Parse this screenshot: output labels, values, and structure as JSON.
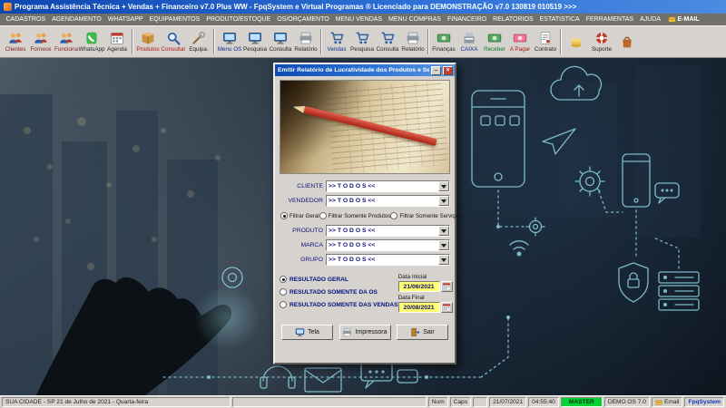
{
  "titlebar": {
    "title": "Programa Assistência Técnica + Vendas + Financeiro v7.0 Plus WW  -  FpqSystem e Virtual Programas ®  Licenciado para  DEMONSTRAÇÃO v7.0 130819 010519 >>>"
  },
  "menubar": {
    "items": [
      "CADASTROS",
      "AGENDAMENTO",
      "WHATSAPP",
      "EQUIPAMENTOS",
      "PRODUTO/ESTOQUE",
      "OS/ORÇAMENTO",
      "MENU VENDAS",
      "MENU COMPRAS",
      "FINANCEIRO",
      "RELATORIOS",
      "ESTATISTICA",
      "FERRAMENTAS",
      "AJUDA"
    ],
    "email": "E-MAIL"
  },
  "toolbar": {
    "buttons": [
      {
        "label": "Clientes",
        "icon": "people-icon"
      },
      {
        "label": "Fornece",
        "icon": "people-icon"
      },
      {
        "label": "Funciona",
        "icon": "people-icon"
      },
      {
        "label": "WhatsApp",
        "icon": "whatsapp-phone-icon"
      },
      {
        "label": "Agenda",
        "icon": "calendar-icon"
      },
      {
        "label": "Produtos",
        "icon": "box-icon"
      },
      {
        "label": "Consultar",
        "icon": "search-icon"
      },
      {
        "label": "Equipa.",
        "icon": "tools-icon"
      },
      {
        "label": "Menu OS",
        "icon": "monitor-icon"
      },
      {
        "label": "Pesquisa",
        "icon": "monitor-icon"
      },
      {
        "label": "Consulta",
        "icon": "monitor-icon"
      },
      {
        "label": "Relatório",
        "icon": "printer-icon"
      },
      {
        "label": "Vendas",
        "icon": "cart-icon"
      },
      {
        "label": "Pesquisa",
        "icon": "cart-icon"
      },
      {
        "label": "Consulta",
        "icon": "cart-icon"
      },
      {
        "label": "Relatório",
        "icon": "printer-icon"
      },
      {
        "label": "Finanças",
        "icon": "money-icon"
      },
      {
        "label": "CAIXA",
        "icon": "cash-register-icon"
      },
      {
        "label": "Receber",
        "icon": "money-icon"
      },
      {
        "label": "A Pagar",
        "icon": "money-icon"
      },
      {
        "label": "Contrato",
        "icon": "contract-icon"
      },
      {
        "label": "",
        "icon": "coins-icon"
      },
      {
        "label": "Suporte",
        "icon": "support-icon"
      },
      {
        "label": "",
        "icon": "bag-icon"
      }
    ]
  },
  "dialog": {
    "title": "Emitir Relatório de Lucratividade dos Produtos e Serviços",
    "cliente_label": "CLIENTE",
    "cliente_value": ">> T O D O S <<",
    "vendedor_label": "VENDEDOR",
    "vendedor_value": ">> T O D O S <<",
    "filter_options": [
      "Filtrar Geral",
      "Filtrar Somente Produtos",
      "Filtrar Somente Serviços"
    ],
    "filter_selected": "Filtrar Geral",
    "produto_label": "PRODUTO",
    "produto_value": ">> T O D O S <<",
    "marca_label": "MARCA",
    "marca_value": ">> T O D O S <<",
    "grupo_label": "GRUPO",
    "grupo_value": ">> T O D O S <<",
    "result_options": [
      "RESULTADO GERAL",
      "RESULTADO SOMENTE DA OS",
      "RESULTADO SOMENTE DAS VENDAS"
    ],
    "result_selected": "RESULTADO GERAL",
    "data_inicial_label": "Data Inicial",
    "data_inicial": "21/06/2021",
    "data_final_label": "Data Final",
    "data_final": "20/08/2021",
    "buttons": {
      "tela": "Tela",
      "impressora": "Impressora",
      "sair": "Sair"
    }
  },
  "statusbar": {
    "location": "SUA CIDADE - SP 21 de Julho de 2021 - Quarta-feira",
    "num": "Num",
    "caps": "Caps",
    "date": "21/07/2021",
    "time": "04:55:40",
    "master": "MASTER",
    "demo": "DEMO OS 7.0",
    "email": "Email",
    "brand": "FpqSystem"
  },
  "colors": {
    "titlebar_blue": "#0d47b0",
    "date_field_yellow": "#ffff70",
    "master_green": "#00d435",
    "background_icon_cyan": "#8fd4e6"
  }
}
